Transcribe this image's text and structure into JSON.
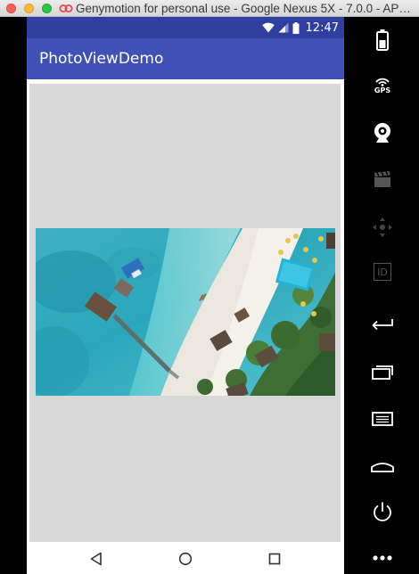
{
  "window": {
    "title": "Genymotion for personal use - Google Nexus 5X - 7.0.0 - AP…"
  },
  "status_bar": {
    "time": "12:47",
    "icons": [
      "wifi-icon",
      "signal-icon",
      "battery-icon"
    ]
  },
  "app_bar": {
    "title": "PhotoViewDemo"
  },
  "photo": {
    "description_icon": "aerial-beach-photo"
  },
  "navigation": {
    "buttons": [
      "back-icon",
      "home-icon",
      "recents-icon"
    ]
  },
  "side_toolbar": {
    "tools": [
      "battery-tool-icon",
      "gps-tool-icon",
      "camera-tool-icon",
      "video-capture-icon",
      "dpad-icon",
      "device-id-icon",
      "back-tool-icon",
      "recents-tool-icon",
      "menu-tool-icon",
      "home-tool-icon",
      "power-tool-icon",
      "more-icon"
    ],
    "gps_label": "GPS",
    "id_label": "ID"
  },
  "colors": {
    "status_bar": "#303f9f",
    "app_bar": "#3f51b5",
    "photo_background": "#d7d8d7"
  }
}
